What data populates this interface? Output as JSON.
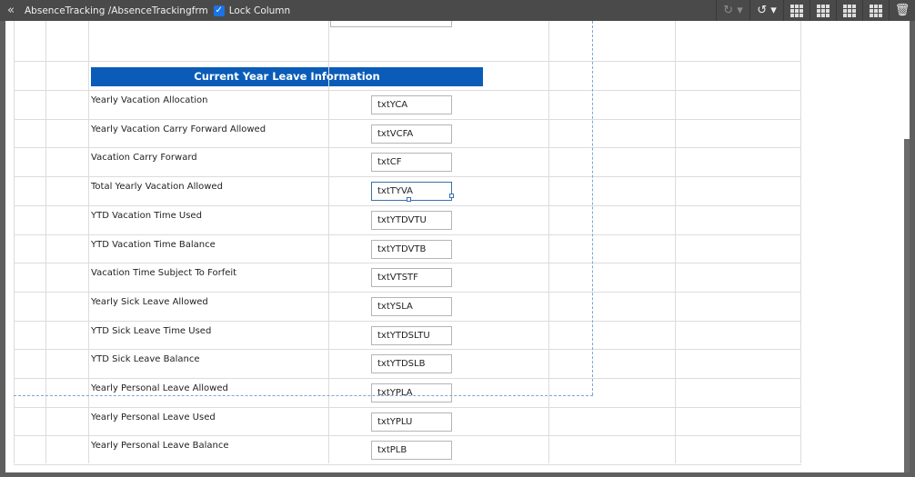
{
  "toolbar": {
    "path": "AbsenceTracking /AbsenceTrackingfrm",
    "lock_label": "Lock Column",
    "lock_checked": true
  },
  "section": {
    "title": "Current Year Leave Information"
  },
  "rows": [
    {
      "label": "Yearly Vacation Allocation",
      "field": "txtYCA"
    },
    {
      "label": "Yearly Vacation Carry Forward Allowed",
      "field": "txtVCFA"
    },
    {
      "label": "Vacation Carry Forward",
      "field": "txtCF"
    },
    {
      "label": "Total Yearly Vacation Allowed",
      "field": "txtTYVA"
    },
    {
      "label": "YTD Vacation Time Used",
      "field": "txtYTDVTU"
    },
    {
      "label": "YTD Vacation Time Balance",
      "field": "txtYTDVTB"
    },
    {
      "label": "Vacation Time Subject To Forfeit",
      "field": "txtVTSTF"
    },
    {
      "label": "Yearly Sick Leave Allowed",
      "field": "txtYSLA"
    },
    {
      "label": "YTD Sick Leave Time Used",
      "field": "txtYTDSLTU"
    },
    {
      "label": "YTD Sick Leave Balance",
      "field": "txtYTDSLB"
    },
    {
      "label": "Yearly Personal Leave Allowed",
      "field": "txtYPLA"
    },
    {
      "label": "Yearly Personal Leave Used",
      "field": "txtYPLU"
    },
    {
      "label": "Yearly Personal Leave Balance",
      "field": "txtPLB"
    }
  ],
  "colors": {
    "header": "#0a5cb8",
    "toolbar": "#4a4a4a",
    "selection": "#3a6fb0"
  }
}
